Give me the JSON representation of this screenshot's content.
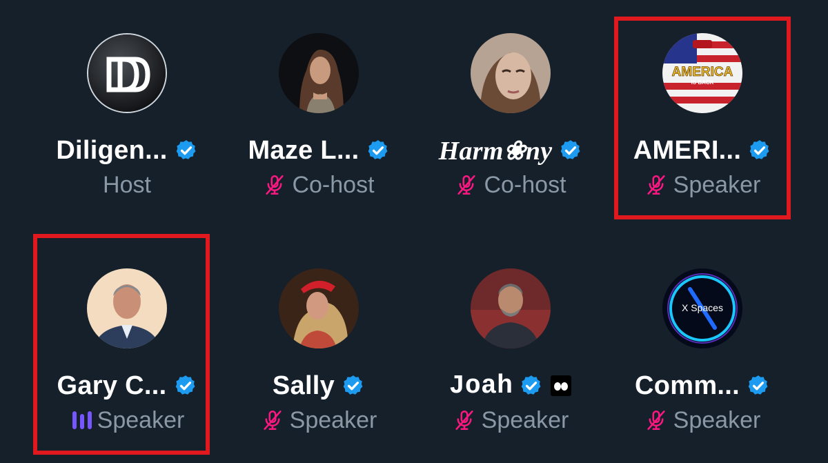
{
  "participants": [
    {
      "name": "Diligen...",
      "role": "Host",
      "verified": true,
      "muted": false,
      "avatar_icon": "dd-logo-icon"
    },
    {
      "name": "Maze L...",
      "role": "Co-host",
      "verified": true,
      "muted": true,
      "avatar_icon": "user-photo-icon"
    },
    {
      "name": "Harm❀ny",
      "role": "Co-host",
      "verified": true,
      "muted": true,
      "avatar_icon": "user-photo-icon"
    },
    {
      "name": "AMERI...",
      "role": "Speaker",
      "verified": true,
      "muted": true,
      "avatar_icon": "america-is-back-logo-icon",
      "avatar_text": "AMERICA",
      "avatar_subtext": "IS BACK",
      "highlighted": true
    },
    {
      "name": "Gary C...",
      "role": "Speaker",
      "verified": true,
      "muted": false,
      "speaking": true,
      "avatar_icon": "user-photo-icon",
      "highlighted": true
    },
    {
      "name": "Sally",
      "role": "Speaker",
      "verified": true,
      "muted": true,
      "avatar_icon": "user-photo-icon"
    },
    {
      "name": "Joah",
      "role": "Speaker",
      "verified": true,
      "muted": true,
      "avatar_icon": "user-photo-icon",
      "extra_badge": "eyes-badge-icon"
    },
    {
      "name": "Comm...",
      "role": "Speaker",
      "verified": true,
      "muted": true,
      "avatar_icon": "x-spaces-logo-icon",
      "avatar_text": "X Spaces"
    }
  ],
  "colors": {
    "background": "#15202b",
    "verified": "#1d9bf0",
    "muted_mic": "#f91880",
    "role_text": "#8b98a5",
    "speaking": "#7856ff",
    "highlight": "#e0191f"
  }
}
